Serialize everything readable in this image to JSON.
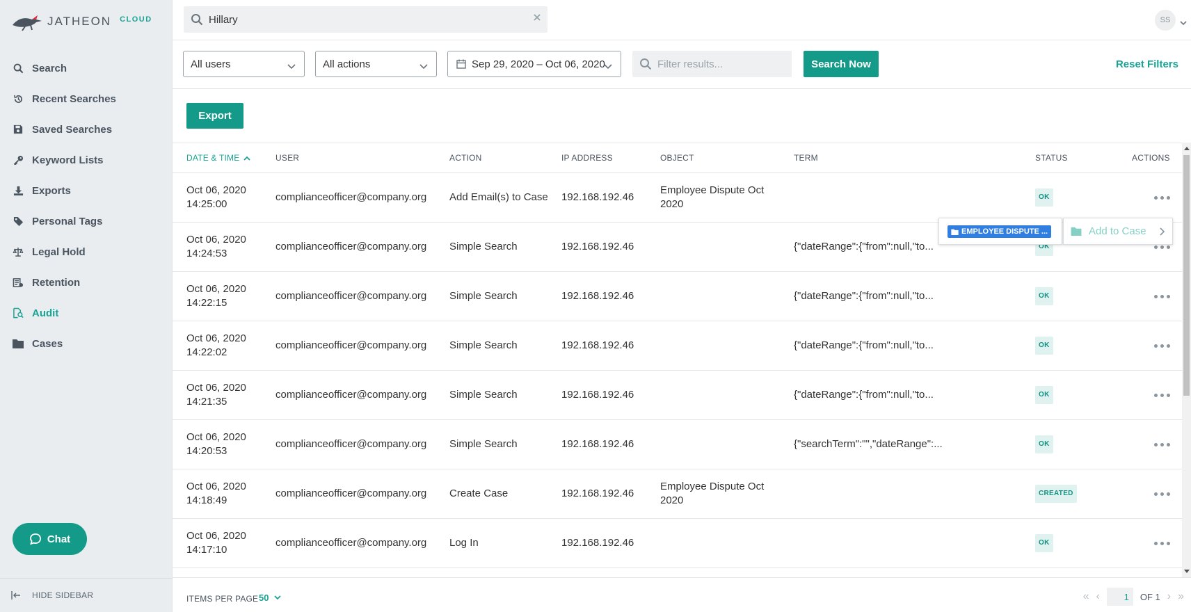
{
  "app": {
    "brand": "JATHEON",
    "brand_suffix": "CLOUD"
  },
  "sidebar": {
    "items": [
      {
        "label": "Search",
        "icon": "search-icon"
      },
      {
        "label": "Recent Searches",
        "icon": "history-icon"
      },
      {
        "label": "Saved Searches",
        "icon": "floppy-disk-icon"
      },
      {
        "label": "Keyword Lists",
        "icon": "key-icon"
      },
      {
        "label": "Exports",
        "icon": "download-icon"
      },
      {
        "label": "Personal Tags",
        "icon": "tag-icon"
      },
      {
        "label": "Legal Hold",
        "icon": "scales-icon"
      },
      {
        "label": "Retention",
        "icon": "retention-icon"
      },
      {
        "label": "Audit",
        "icon": "audit-icon",
        "active": true
      },
      {
        "label": "Cases",
        "icon": "folder-icon"
      }
    ],
    "chat_label": "Chat",
    "hide_label": "HIDE SIDEBAR"
  },
  "topbar": {
    "search_value": "Hillary",
    "user_initials": "SS"
  },
  "filters": {
    "users": "All users",
    "actions": "All actions",
    "date_range": "Sep 29, 2020 – Oct 06, 2020",
    "filter_placeholder": "Filter results...",
    "search_button": "Search Now",
    "reset": "Reset Filters"
  },
  "toolbar": {
    "export_label": "Export"
  },
  "table": {
    "headers": {
      "date": "DATE & TIME",
      "user": "USER",
      "action": "ACTION",
      "ip": "IP ADDRESS",
      "object": "OBJECT",
      "term": "TERM",
      "status": "STATUS",
      "actions": "ACTIONS"
    },
    "rows": [
      {
        "date": "Oct 06, 2020",
        "time": "14:25:00",
        "user": "complianceofficer@company.org",
        "action": "Add Email(s) to Case",
        "ip": "192.168.192.46",
        "object": "Employee Dispute Oct 2020",
        "term": "",
        "status": "OK"
      },
      {
        "date": "Oct 06, 2020",
        "time": "14:24:53",
        "user": "complianceofficer@company.org",
        "action": "Simple Search",
        "ip": "192.168.192.46",
        "object": "",
        "term": "{\"dateRange\":{\"from\":null,\"to...",
        "status": "OK"
      },
      {
        "date": "Oct 06, 2020",
        "time": "14:22:15",
        "user": "complianceofficer@company.org",
        "action": "Simple Search",
        "ip": "192.168.192.46",
        "object": "",
        "term": "{\"dateRange\":{\"from\":null,\"to...",
        "status": "OK"
      },
      {
        "date": "Oct 06, 2020",
        "time": "14:22:02",
        "user": "complianceofficer@company.org",
        "action": "Simple Search",
        "ip": "192.168.192.46",
        "object": "",
        "term": "{\"dateRange\":{\"from\":null,\"to...",
        "status": "OK"
      },
      {
        "date": "Oct 06, 2020",
        "time": "14:21:35",
        "user": "complianceofficer@company.org",
        "action": "Simple Search",
        "ip": "192.168.192.46",
        "object": "",
        "term": "{\"dateRange\":{\"from\":null,\"to...",
        "status": "OK"
      },
      {
        "date": "Oct 06, 2020",
        "time": "14:20:53",
        "user": "complianceofficer@company.org",
        "action": "Simple Search",
        "ip": "192.168.192.46",
        "object": "",
        "term": "{\"searchTerm\":\"\",\"dateRange\":...",
        "status": "OK"
      },
      {
        "date": "Oct 06, 2020",
        "time": "14:18:49",
        "user": "complianceofficer@company.org",
        "action": "Create Case",
        "ip": "192.168.192.46",
        "object": "Employee Dispute Oct 2020",
        "term": "",
        "status": "CREATED"
      },
      {
        "date": "Oct 06, 2020",
        "time": "14:17:10",
        "user": "complianceofficer@company.org",
        "action": "Log In",
        "ip": "192.168.192.46",
        "object": "",
        "term": "",
        "status": "OK"
      }
    ]
  },
  "popup": {
    "case_tag": "EMPLOYEE DISPUTE ...",
    "add_to_case": "Add to Case"
  },
  "footer": {
    "items_per_page_label": "ITEMS PER PAGE",
    "items_per_page_value": "50",
    "page_current": "1",
    "page_of": "OF 1"
  },
  "colors": {
    "accent": "#149a88",
    "chip_blue": "#2f7ee0",
    "sidebar_bg": "#e9edf0"
  }
}
